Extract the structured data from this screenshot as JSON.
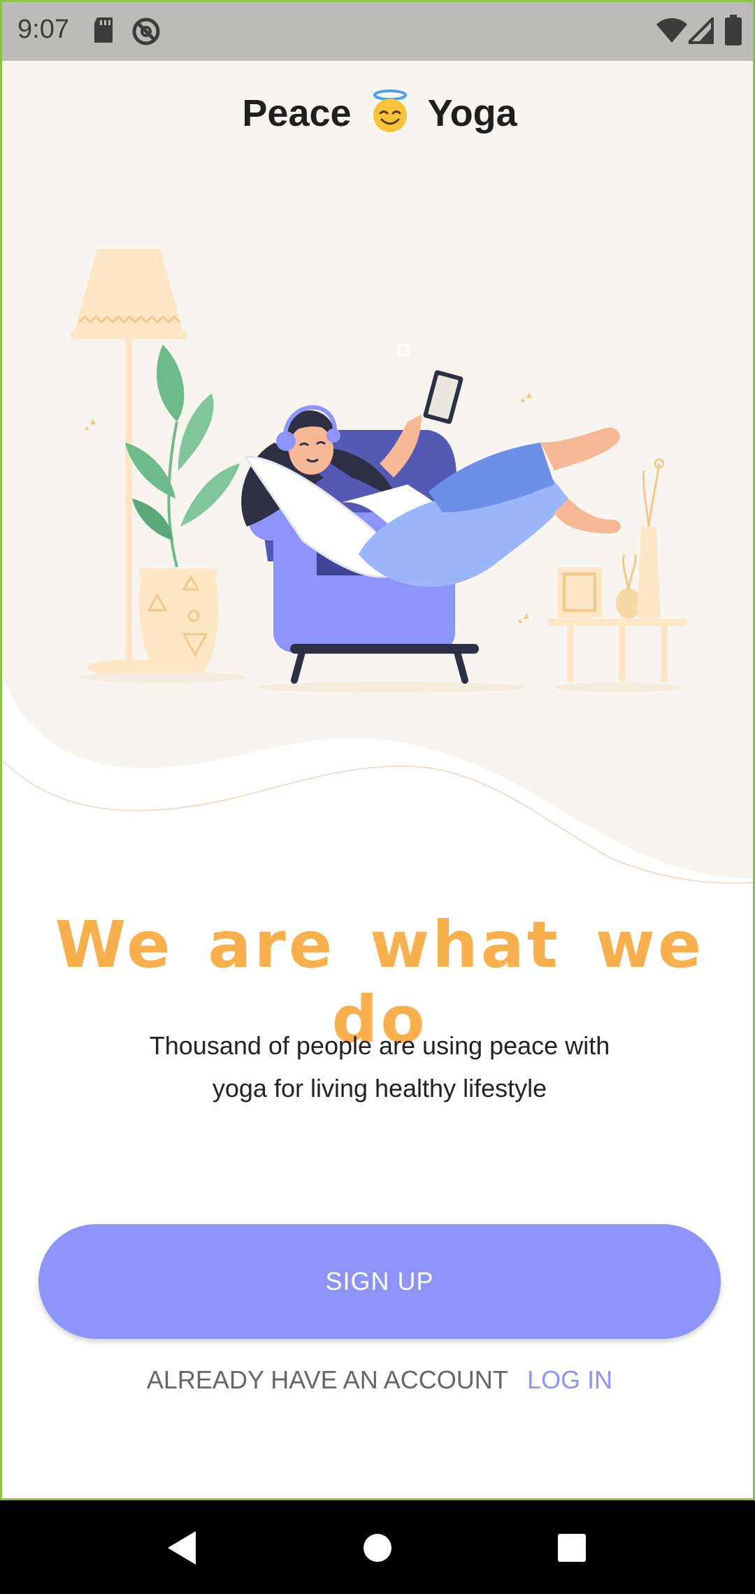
{
  "status_bar": {
    "time": "9:07",
    "left_icons": [
      "sd-card-icon",
      "do-not-disturb-icon"
    ],
    "right_icons": [
      "wifi-icon",
      "cell-signal-icon",
      "battery-icon"
    ]
  },
  "app": {
    "title_before": "Peace",
    "title_emoji": "smiling-face-with-halo-icon",
    "title_after": "Yoga"
  },
  "illustration": "woman-relaxing-on-armchair-illustration",
  "content": {
    "headline": "We are what we do",
    "subtitle_line1": "Thousand of people are using peace with",
    "subtitle_line2": "yoga for living healthy lifestyle"
  },
  "actions": {
    "signup_label": "SIGN UP",
    "login_prompt": "ALREADY HAVE AN ACCOUNT",
    "login_label": "LOG IN"
  },
  "nav_bar": {
    "buttons": [
      "back-icon",
      "home-icon",
      "recents-icon"
    ]
  },
  "colors": {
    "accent": "#8c94f8",
    "headline": "#f8b04e",
    "hero_background": "#f8f5f1"
  }
}
